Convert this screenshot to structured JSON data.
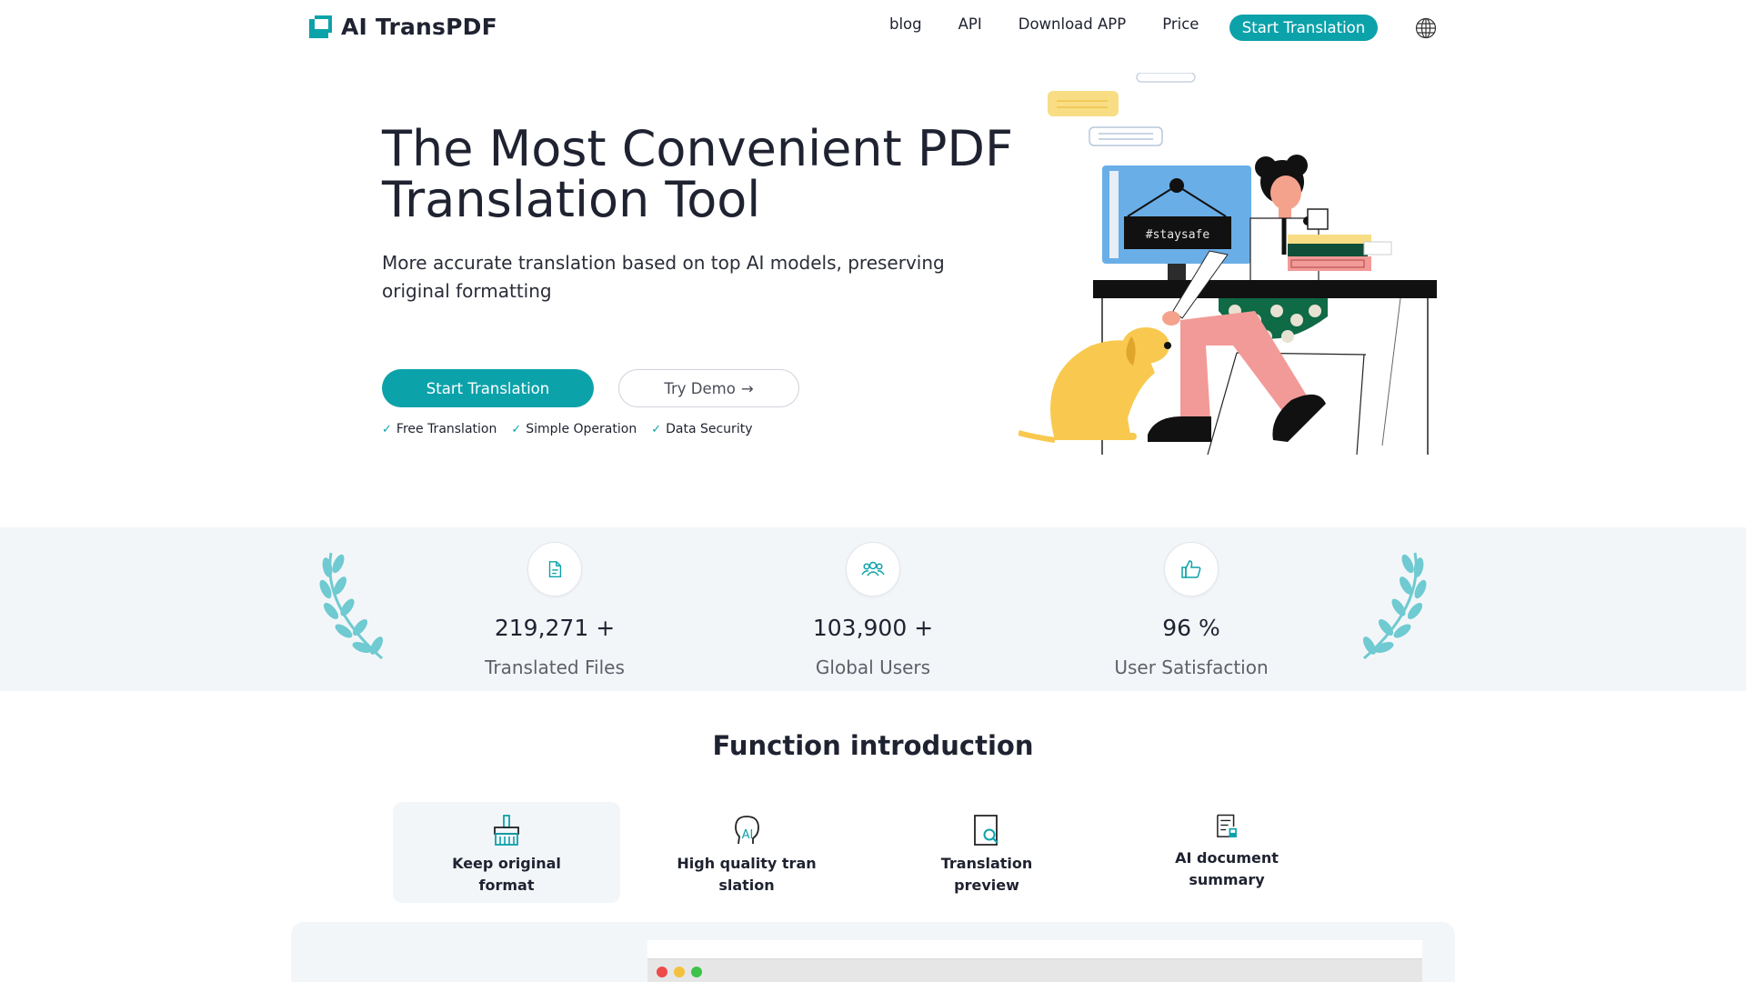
{
  "header": {
    "brand": "AI TransPDF",
    "nav": [
      "blog",
      "API",
      "Download APP",
      "Price"
    ],
    "cta": "Start Translation",
    "globe_icon": "globe-icon"
  },
  "hero": {
    "title": "The Most Convenient PDF Translation Tool",
    "subtitle": "More accurate translation based on top AI models, preserving original formatting",
    "primary_button": "Start Translation",
    "demo_button": "Try Demo",
    "demo_arrow": "→",
    "features": [
      "Free Translation",
      "Simple Operation",
      "Data Security"
    ],
    "illustration_sign": "#staysafe"
  },
  "stats": [
    {
      "icon": "document-icon",
      "value": "219,271 +",
      "label": "Translated Files"
    },
    {
      "icon": "users-icon",
      "value": "103,900 +",
      "label": "Global Users"
    },
    {
      "icon": "thumbs-up-icon",
      "value": "96 %",
      "label": "User Satisfaction"
    }
  ],
  "functions": {
    "title": "Function introduction",
    "tabs": [
      {
        "icon": "brush-icon",
        "label": "Keep original format",
        "active": true
      },
      {
        "icon": "ai-head-icon",
        "label": "High quality translation",
        "active": false
      },
      {
        "icon": "preview-search-icon",
        "label": "Translation preview",
        "active": false
      },
      {
        "icon": "summary-doc-icon",
        "label": "AI document summary",
        "active": false
      }
    ]
  },
  "colors": {
    "accent": "#0ca2aa",
    "text": "#1f2230",
    "band": "#f3f6f9",
    "laurel": "#6fcad1"
  }
}
